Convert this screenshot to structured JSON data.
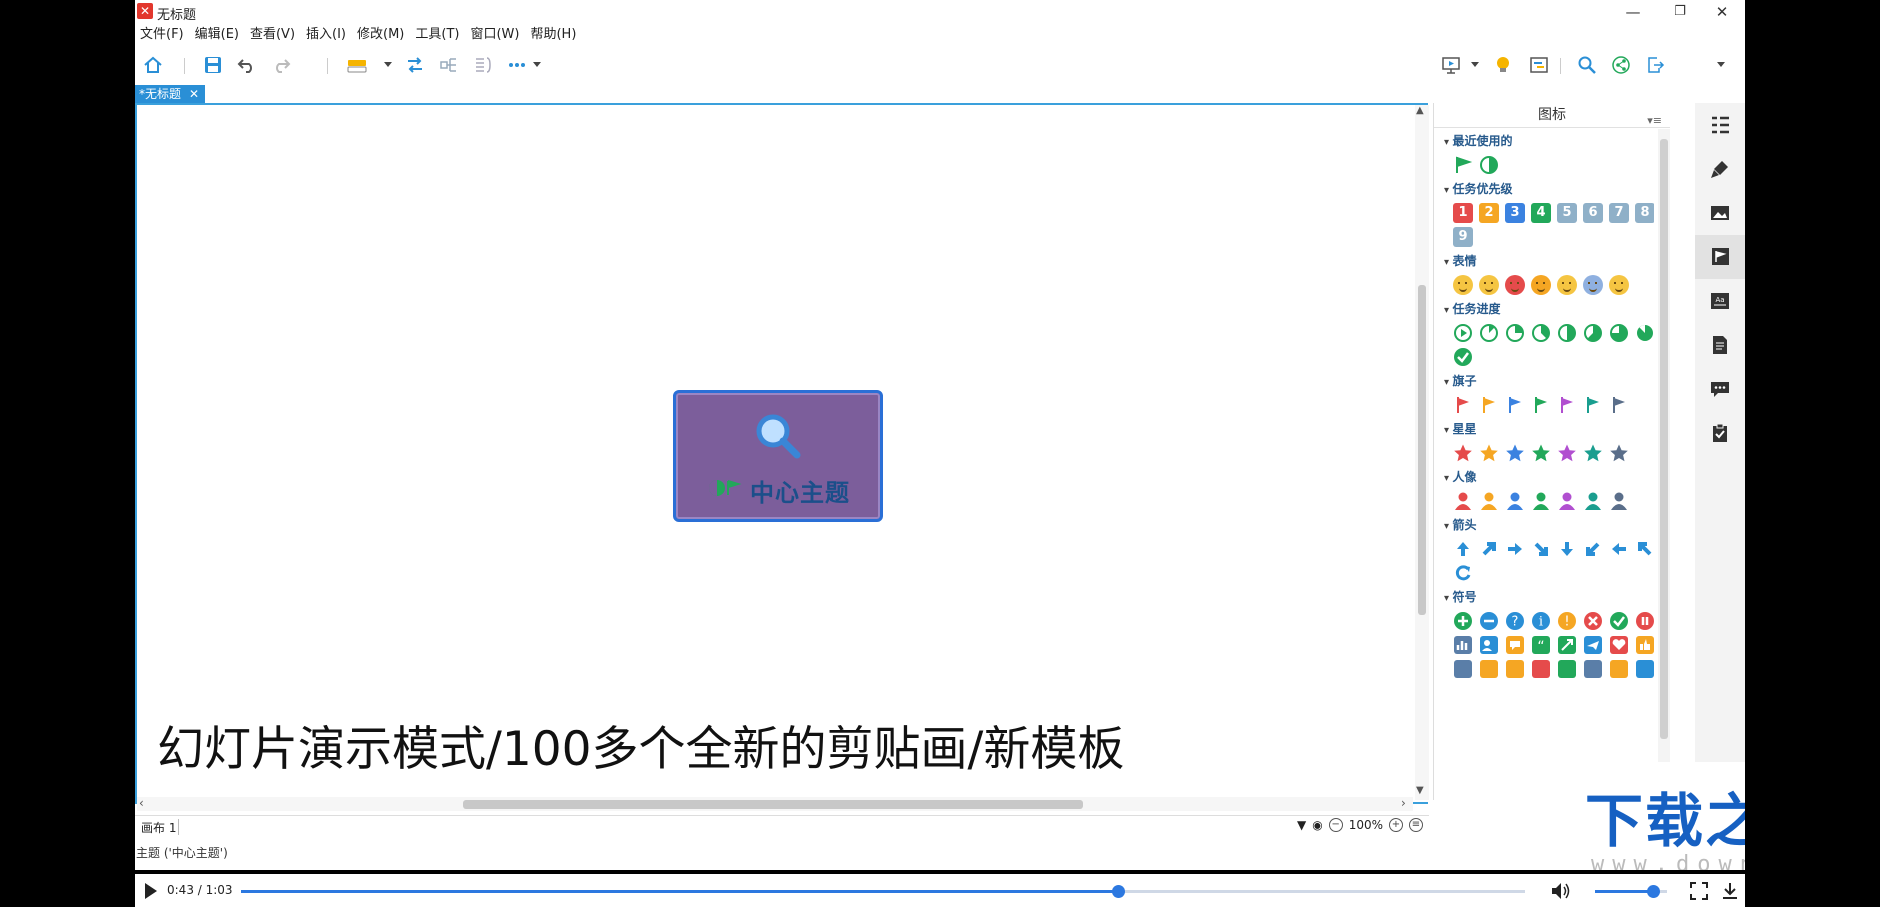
{
  "window": {
    "title": "无标题",
    "minimize": "—",
    "maximize": "❐",
    "close": "✕"
  },
  "menu": [
    "文件(F)",
    "编辑(E)",
    "查看(V)",
    "插入(I)",
    "修改(M)",
    "工具(T)",
    "窗口(W)",
    "帮助(H)"
  ],
  "doc_tab": {
    "label": "*无标题",
    "close": "✕"
  },
  "canvas": {
    "central_topic": "中心主题",
    "subtitle": "幻灯片演示模式/100多个全新的剪贴画/新模板",
    "topic_color": "#7c5e9b"
  },
  "sheet": {
    "label": "画布 1",
    "zoom": "100%"
  },
  "status": "主题 ('中心主题')",
  "panel": {
    "title": "图标",
    "sections": [
      {
        "title": "最近使用的"
      },
      {
        "title": "任务优先级",
        "numbers": [
          "1",
          "2",
          "3",
          "4",
          "5",
          "6",
          "7",
          "8",
          "9"
        ],
        "colors": [
          "#e54b4b",
          "#f5a623",
          "#3b82e0",
          "#22a85a",
          "#8fb0c8",
          "#8fb0c8",
          "#8fb0c8",
          "#8fb0c8",
          "#8fb0c8"
        ]
      },
      {
        "title": "表情"
      },
      {
        "title": "任务进度"
      },
      {
        "title": "旗子",
        "colors": [
          "#e54b4b",
          "#f5a623",
          "#3b82e0",
          "#22a85a",
          "#b14fd0",
          "#1a9e8f",
          "#5a6e8a"
        ]
      },
      {
        "title": "星星",
        "colors": [
          "#e54b4b",
          "#f5a623",
          "#3b82e0",
          "#22a85a",
          "#b14fd0",
          "#1a9e8f",
          "#5a6e8a"
        ]
      },
      {
        "title": "人像",
        "colors": [
          "#e54b4b",
          "#f5a623",
          "#3b82e0",
          "#22a85a",
          "#b14fd0",
          "#1a9e8f",
          "#5a6e8a"
        ]
      },
      {
        "title": "箭头"
      },
      {
        "title": "符号"
      }
    ]
  },
  "watermark": {
    "main": "下载之家",
    "url": "www.downza.cn"
  },
  "player": {
    "time": "0:43 / 1:03",
    "progress": 0.683,
    "volume": 0.8
  },
  "accent": "#2a8fd6"
}
